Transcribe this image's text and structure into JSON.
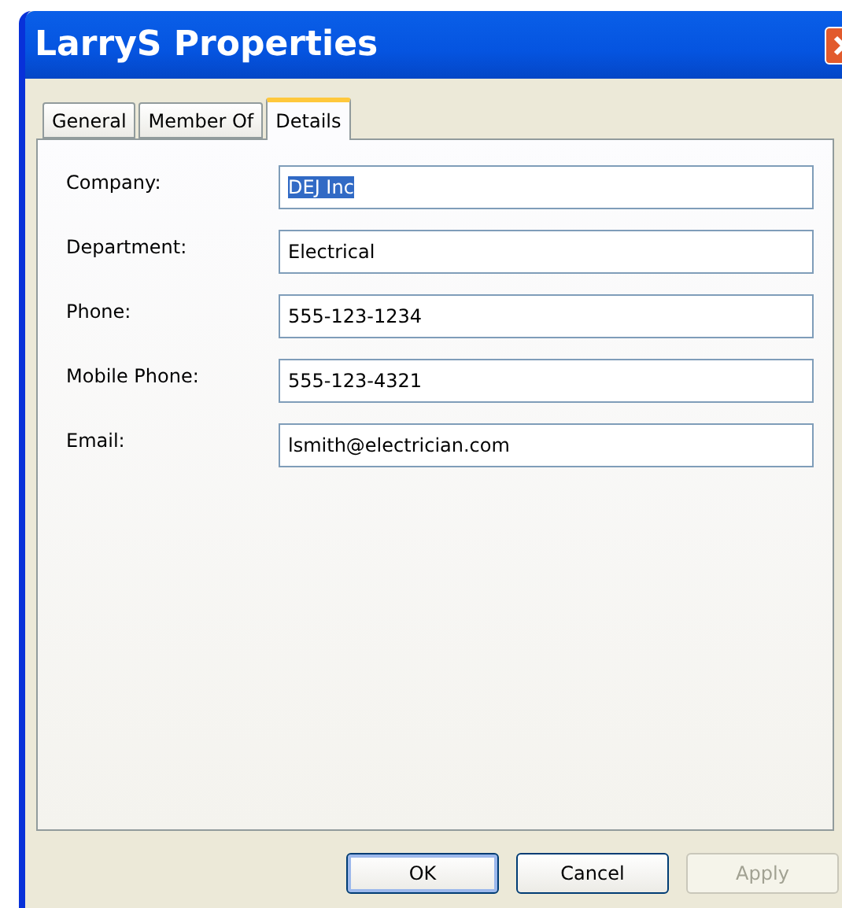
{
  "window": {
    "title": "LarryS Properties"
  },
  "tabs": [
    {
      "label": "General",
      "selected": false
    },
    {
      "label": "Member Of",
      "selected": false
    },
    {
      "label": "Details",
      "selected": true
    }
  ],
  "fields": [
    {
      "label": "Company:",
      "value": "DEJ Inc",
      "highlighted": true
    },
    {
      "label": "Department:",
      "value": "Electrical",
      "highlighted": false
    },
    {
      "label": "Phone:",
      "value": "555-123-1234",
      "highlighted": false
    },
    {
      "label": "Mobile Phone:",
      "value": "555-123-4321",
      "highlighted": false
    },
    {
      "label": "Email:",
      "value": "lsmith@electrician.com",
      "highlighted": false
    }
  ],
  "buttons": [
    {
      "label": "OK",
      "default": true,
      "disabled": false
    },
    {
      "label": "Cancel",
      "default": false,
      "disabled": false
    },
    {
      "label": "Apply",
      "default": false,
      "disabled": true
    }
  ]
}
